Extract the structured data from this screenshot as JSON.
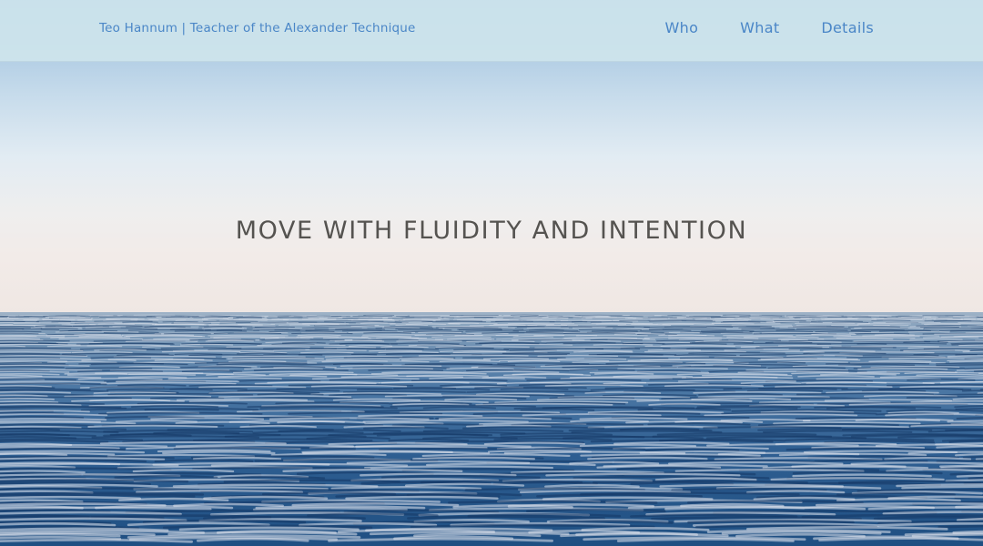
{
  "header": {
    "brand": "Teo Hannum | Teacher of the Alexander Technique",
    "nav": [
      {
        "label": "Who"
      },
      {
        "label": "What"
      },
      {
        "label": "Details"
      }
    ]
  },
  "hero": {
    "headline": "MOVE WITH FLUIDITY AND INTENTION"
  },
  "colors": {
    "nav_text": "#4a86c7",
    "headline_text": "#555350",
    "navbar_bg": "#cde4ec",
    "sea_dark": "#1f4f82"
  }
}
